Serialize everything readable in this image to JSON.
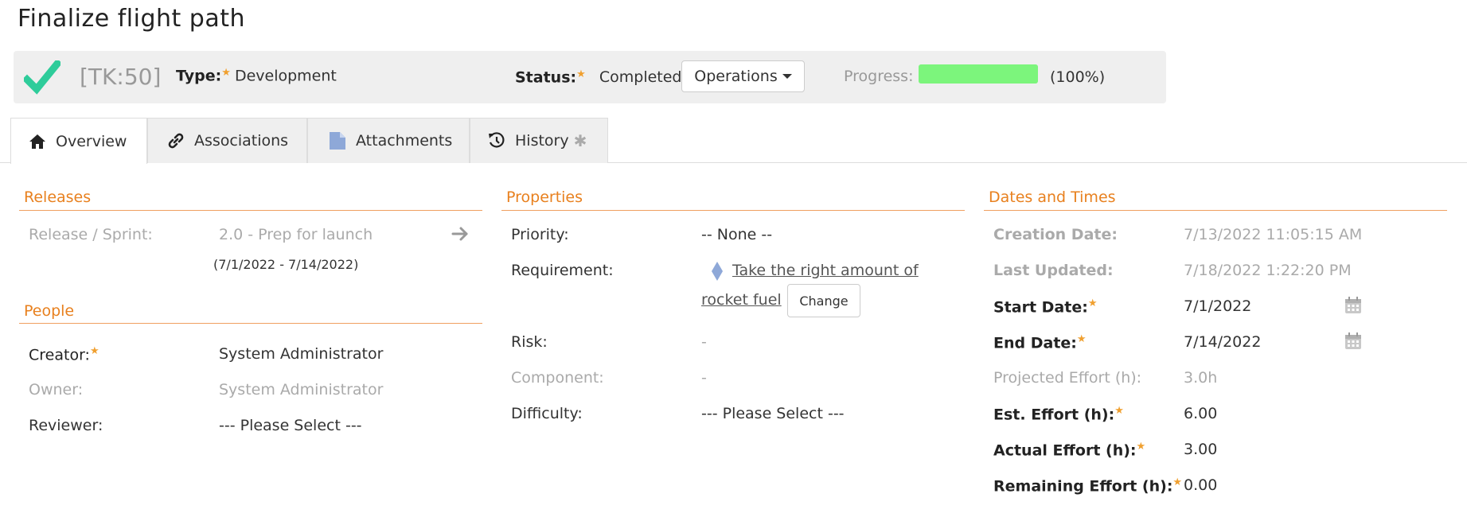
{
  "page": {
    "title": "Finalize flight path"
  },
  "header": {
    "id": "[TK:50]",
    "type_label": "Type:",
    "type_value": "Development",
    "status_label": "Status:",
    "status_value": "Completed",
    "operations_label": "Operations",
    "progress_label": "Progress:",
    "progress_fraction": 1.0,
    "progress_text": "(100%)",
    "progress_color": "#7cf57c",
    "status_icon": "checkmark-icon"
  },
  "tabs": [
    {
      "label": "Overview",
      "icon": "home-icon",
      "active": true
    },
    {
      "label": "Associations",
      "icon": "link-icon"
    },
    {
      "label": "Attachments",
      "icon": "document-icon"
    },
    {
      "label": "History",
      "icon": "history-icon",
      "badge": "✱"
    }
  ],
  "releases": {
    "title": "Releases",
    "label": "Release / Sprint:",
    "value": "2.0 - Prep for launch",
    "dates": "(7/1/2022 - 7/14/2022)"
  },
  "people": {
    "title": "People",
    "creator_label": "Creator:",
    "creator_value": "System Administrator",
    "owner_label": "Owner:",
    "owner_value": "System Administrator",
    "reviewer_label": "Reviewer:",
    "reviewer_value": "--- Please Select ---"
  },
  "properties": {
    "title": "Properties",
    "priority_label": "Priority:",
    "priority_value": "-- None --",
    "requirement_label": "Requirement:",
    "requirement_line1": "Take the right amount of",
    "requirement_line2": "rocket fuel",
    "change_label": "Change",
    "risk_label": "Risk:",
    "risk_value": "-",
    "component_label": "Component:",
    "component_value": "-",
    "difficulty_label": "Difficulty:",
    "difficulty_value": "--- Please Select ---"
  },
  "dates": {
    "title": "Dates and Times",
    "creation_label": "Creation Date:",
    "creation_value": "7/13/2022 11:05:15 AM",
    "updated_label": "Last Updated:",
    "updated_value": "7/18/2022 1:22:20 PM",
    "start_label": "Start Date:",
    "start_value": "7/1/2022",
    "end_label": "End Date:",
    "end_value": "7/14/2022",
    "projected_label": "Projected Effort (h):",
    "projected_value": "3.0h",
    "est_label": "Est. Effort (h):",
    "est_value": "6.00",
    "actual_label": "Actual Effort (h):",
    "actual_value": "3.00",
    "remaining_label": "Remaining Effort (h):",
    "remaining_value": "0.00"
  },
  "colors": {
    "accent": "#e8801e",
    "star": "#f0a030",
    "check": "#2ecc9a"
  }
}
